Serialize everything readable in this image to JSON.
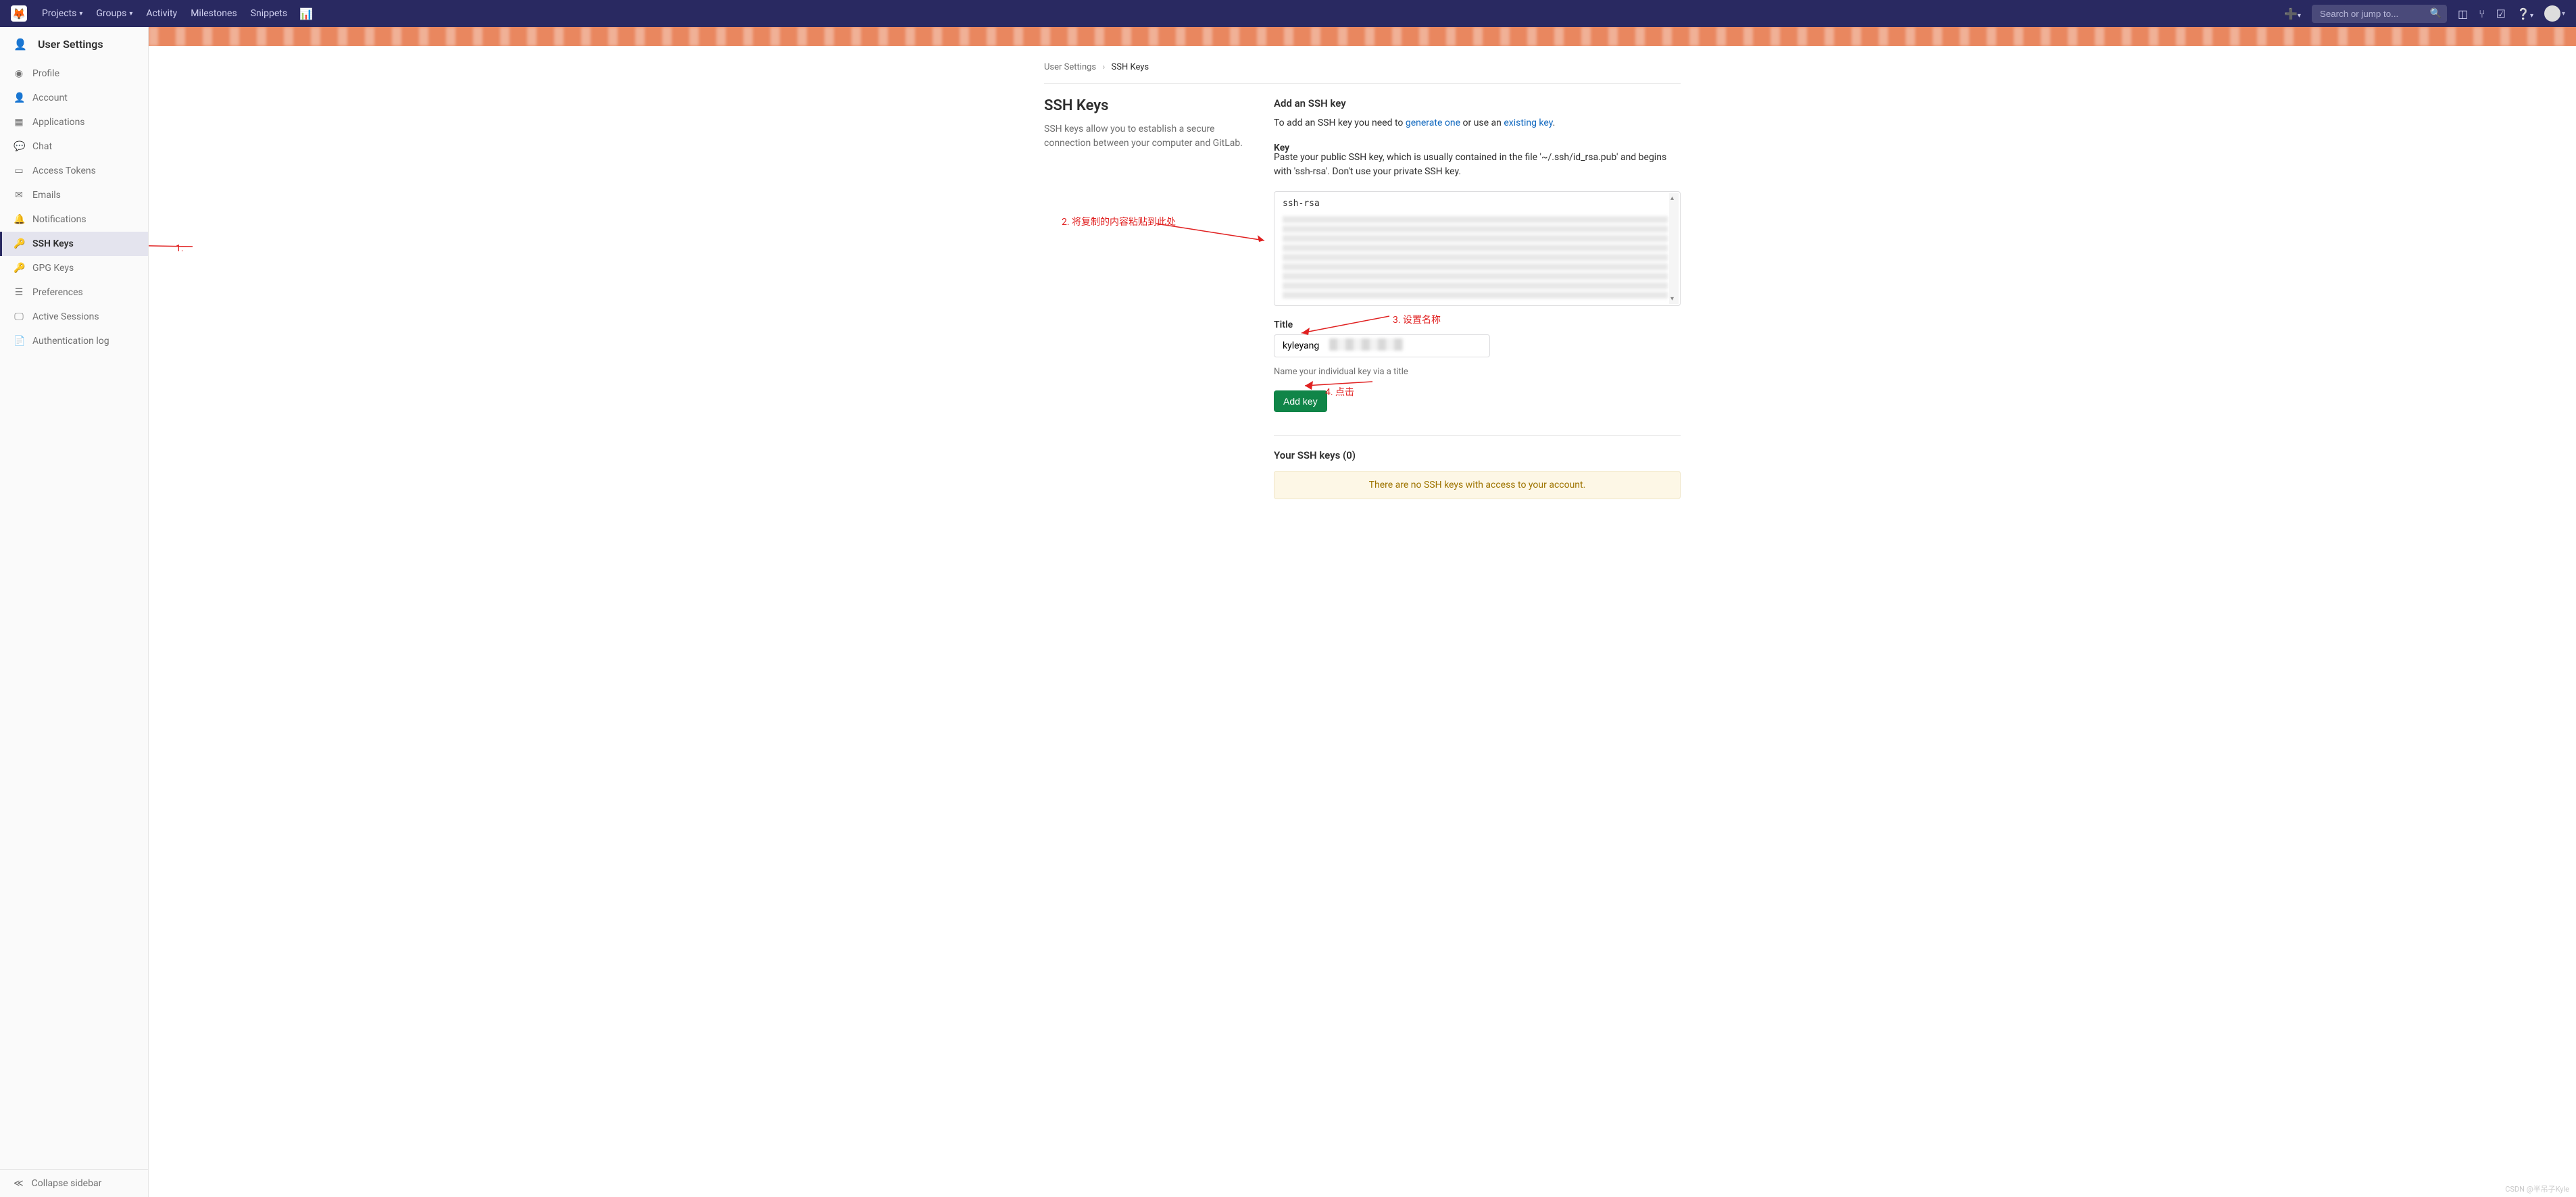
{
  "topnav": {
    "items": [
      {
        "label": "Projects",
        "has_caret": true
      },
      {
        "label": "Groups",
        "has_caret": true
      },
      {
        "label": "Activity",
        "has_caret": false
      },
      {
        "label": "Milestones",
        "has_caret": false
      },
      {
        "label": "Snippets",
        "has_caret": false
      }
    ],
    "search_placeholder": "Search or jump to..."
  },
  "sidebar": {
    "title": "User Settings",
    "items": [
      {
        "label": "Profile",
        "icon": "👤",
        "active": false
      },
      {
        "label": "Account",
        "icon": "⚙",
        "active": false
      },
      {
        "label": "Applications",
        "icon": "▦",
        "active": false
      },
      {
        "label": "Chat",
        "icon": "💬",
        "active": false
      },
      {
        "label": "Access Tokens",
        "icon": "▭",
        "active": false
      },
      {
        "label": "Emails",
        "icon": "✉",
        "active": false
      },
      {
        "label": "Notifications",
        "icon": "🔔",
        "active": false
      },
      {
        "label": "SSH Keys",
        "icon": "🔑",
        "active": true
      },
      {
        "label": "GPG Keys",
        "icon": "🔑",
        "active": false
      },
      {
        "label": "Preferences",
        "icon": "☰",
        "active": false
      },
      {
        "label": "Active Sessions",
        "icon": "🖵",
        "active": false
      },
      {
        "label": "Authentication log",
        "icon": "📄",
        "active": false
      }
    ],
    "collapse_label": "Collapse sidebar"
  },
  "breadcrumb": {
    "root": "User Settings",
    "current": "SSH Keys"
  },
  "left": {
    "title": "SSH Keys",
    "desc": "SSH keys allow you to establish a secure connection between your computer and GitLab."
  },
  "form": {
    "heading": "Add an SSH key",
    "intro_pre": "To add an SSH key you need to ",
    "intro_link1": "generate one",
    "intro_mid": " or use an ",
    "intro_link2": "existing key",
    "intro_post": ".",
    "key_label": "Key",
    "key_help": "Paste your public SSH key, which is usually contained in the file '~/.ssh/id_rsa.pub' and begins with 'ssh-rsa'. Don't use your private SSH key.",
    "key_value_prefix": "ssh-rsa",
    "title_label": "Title",
    "title_value": "kyleyang",
    "title_hint": "Name your individual key via a title",
    "submit_label": "Add key"
  },
  "keys_list": {
    "title": "Your SSH keys (0)",
    "empty": "There are no SSH keys with access to your account."
  },
  "annotations": {
    "a1": "1.",
    "a2": "2. 将复制的内容粘贴到此处",
    "a3": "3. 设置名称",
    "a4": "4. 点击"
  },
  "watermark": "CSDN @半吊子Kyle"
}
